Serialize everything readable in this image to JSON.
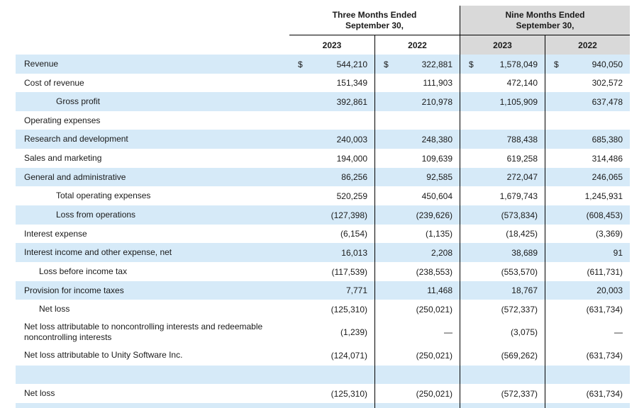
{
  "header": {
    "three_months_line1": "Three Months Ended",
    "three_months_line2": "September 30,",
    "nine_months_line1": "Nine Months Ended",
    "nine_months_line2": "September 30,",
    "years": [
      "2023",
      "2022",
      "2023",
      "2022"
    ]
  },
  "currency_symbol": "$",
  "rows": [
    {
      "label": "Revenue",
      "values": [
        "544,210",
        "322,881",
        "1,578,049",
        "940,050"
      ]
    },
    {
      "label": "Cost of revenue",
      "values": [
        "151,349",
        "111,903",
        "472,140",
        "302,572"
      ]
    },
    {
      "label": "Gross profit",
      "values": [
        "392,861",
        "210,978",
        "1,105,909",
        "637,478"
      ]
    },
    {
      "label": "Operating expenses",
      "values": [
        "",
        "",
        "",
        ""
      ]
    },
    {
      "label": "Research and development",
      "values": [
        "240,003",
        "248,380",
        "788,438",
        "685,380"
      ]
    },
    {
      "label": "Sales and marketing",
      "values": [
        "194,000",
        "109,639",
        "619,258",
        "314,486"
      ]
    },
    {
      "label": "General and administrative",
      "values": [
        "86,256",
        "92,585",
        "272,047",
        "246,065"
      ]
    },
    {
      "label": "Total operating expenses",
      "values": [
        "520,259",
        "450,604",
        "1,679,743",
        "1,245,931"
      ]
    },
    {
      "label": "Loss from operations",
      "values": [
        "(127,398)",
        "(239,626)",
        "(573,834)",
        "(608,453)"
      ]
    },
    {
      "label": "Interest expense",
      "values": [
        "(6,154)",
        "(1,135)",
        "(18,425)",
        "(3,369)"
      ]
    },
    {
      "label": "Interest income and other expense, net",
      "values": [
        "16,013",
        "2,208",
        "38,689",
        "91"
      ]
    },
    {
      "label": "Loss before income tax",
      "values": [
        "(117,539)",
        "(238,553)",
        "(553,570)",
        "(611,731)"
      ]
    },
    {
      "label": "Provision for income taxes",
      "values": [
        "7,771",
        "11,468",
        "18,767",
        "20,003"
      ]
    },
    {
      "label": "Net loss",
      "values": [
        "(125,310)",
        "(250,021)",
        "(572,337)",
        "(631,734)"
      ]
    },
    {
      "label": "Net loss attributable to noncontrolling interests and redeemable noncontrolling interests",
      "values": [
        "(1,239)",
        "—",
        "(3,075)",
        "—"
      ]
    },
    {
      "label": "Net loss attributable to Unity Software Inc.",
      "values": [
        "(124,071)",
        "(250,021)",
        "(569,262)",
        "(631,734)"
      ]
    },
    {
      "label": "",
      "values": [
        "",
        "",
        "",
        ""
      ]
    },
    {
      "label": "Net loss",
      "values": [
        "(125,310)",
        "(250,021)",
        "(572,337)",
        "(631,734)"
      ]
    },
    {
      "label": "",
      "values": [
        "",
        "",
        "",
        ""
      ]
    }
  ]
}
